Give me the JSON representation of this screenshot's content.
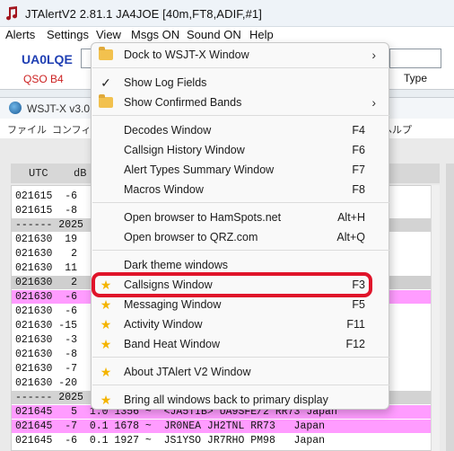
{
  "jtalert": {
    "title": "JTAlertV2  2.81.1 JA4JOE [40m,FT8,ADIF,#1]",
    "menu": [
      "Alerts",
      "Settings",
      "View",
      "Msgs ON",
      "Sound ON",
      "Help"
    ],
    "callsign": "UA0LQE",
    "qso_label": "QSO B4",
    "type_label": "Type"
  },
  "wsjtx": {
    "title": "WSJT-X   v3.0",
    "menu": [
      "ファイル",
      "コンフィグ",
      "ヘルプ"
    ],
    "header": {
      "utc": "UTC",
      "db": "dB"
    },
    "rows": [
      {
        "text": "021615  -6",
        "style": "plain"
      },
      {
        "text": "021615  -8",
        "style": "plain"
      },
      {
        "text": "------ 2025",
        "style": "sep"
      },
      {
        "text": "021630  19",
        "style": "plain"
      },
      {
        "text": "021630   2",
        "style": "plain"
      },
      {
        "text": "021630  11",
        "style": "plain"
      },
      {
        "text": "021630   2",
        "style": "grey"
      },
      {
        "text": "021630  -6",
        "style": "pink"
      },
      {
        "text": "021630  -6",
        "style": "plain"
      },
      {
        "text": "021630 -15",
        "style": "plain"
      },
      {
        "text": "021630  -3",
        "style": "plain"
      },
      {
        "text": "021630  -8",
        "style": "plain"
      },
      {
        "text": "021630  -7",
        "style": "plain"
      },
      {
        "text": "021630 -20",
        "style": "plain"
      },
      {
        "text": "------ 2025",
        "style": "sep"
      },
      {
        "text": "021645   5  1.0 1356 ~  <JA5TIB> UA9SFE/2 RR73 Japan",
        "style": "pink"
      },
      {
        "text": "021645  -7  0.1 1678 ~  JR0NEA JH2TNL RR73   Japan",
        "style": "pink"
      },
      {
        "text": "021645  -6  0.1 1927 ~  JS1YSO JR7RHO PM98   Japan",
        "style": "plain"
      }
    ]
  },
  "view_menu": {
    "items": [
      {
        "icon": "folder-icon",
        "label": "Dock to WSJT-X Window",
        "shortcut": "",
        "submenu": true
      },
      {
        "icon": "check-icon",
        "label": "Show Log Fields",
        "shortcut": "",
        "submenu": false
      },
      {
        "icon": "folder-icon",
        "label": "Show Confirmed Bands",
        "shortcut": "",
        "submenu": true
      },
      {
        "icon": "",
        "label": "Decodes Window",
        "shortcut": "F4",
        "submenu": false
      },
      {
        "icon": "",
        "label": "Callsign History Window",
        "shortcut": "F6",
        "submenu": false
      },
      {
        "icon": "",
        "label": "Alert Types Summary Window",
        "shortcut": "F7",
        "submenu": false
      },
      {
        "icon": "",
        "label": "Macros Window",
        "shortcut": "F8",
        "submenu": false
      },
      {
        "icon": "",
        "label": "Open browser to HamSpots.net",
        "shortcut": "Alt+H",
        "submenu": false
      },
      {
        "icon": "",
        "label": "Open browser to QRZ.com",
        "shortcut": "Alt+Q",
        "submenu": false
      },
      {
        "icon": "",
        "label": "Dark theme windows",
        "shortcut": "",
        "submenu": false
      },
      {
        "icon": "star-icon",
        "label": "Callsigns Window",
        "shortcut": "F3",
        "submenu": false
      },
      {
        "icon": "star-icon",
        "label": "Messaging Window",
        "shortcut": "F5",
        "submenu": false
      },
      {
        "icon": "star-icon",
        "label": "Activity Window",
        "shortcut": "F11",
        "submenu": false
      },
      {
        "icon": "star-icon",
        "label": "Band Heat Window",
        "shortcut": "F12",
        "submenu": false
      },
      {
        "icon": "star-icon",
        "label": "About JTAlert V2 Window",
        "shortcut": "",
        "submenu": false
      },
      {
        "icon": "star-icon",
        "label": "Bring all windows back to primary display",
        "shortcut": "",
        "submenu": false
      }
    ],
    "highlighted": "Callsigns Window",
    "highlight_color": "#e0142a"
  }
}
